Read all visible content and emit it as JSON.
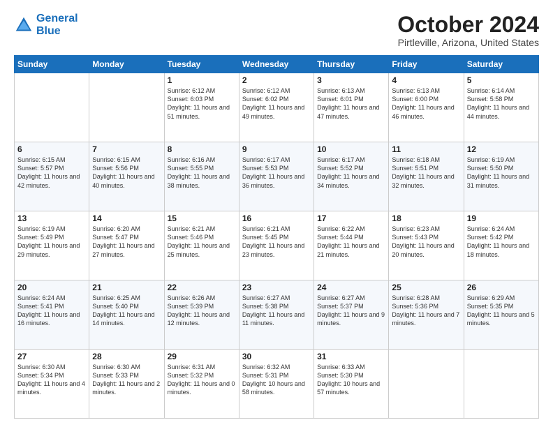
{
  "header": {
    "logo_line1": "General",
    "logo_line2": "Blue",
    "month": "October 2024",
    "location": "Pirtleville, Arizona, United States"
  },
  "days_of_week": [
    "Sunday",
    "Monday",
    "Tuesday",
    "Wednesday",
    "Thursday",
    "Friday",
    "Saturday"
  ],
  "weeks": [
    [
      {
        "day": "",
        "sunrise": "",
        "sunset": "",
        "daylight": ""
      },
      {
        "day": "",
        "sunrise": "",
        "sunset": "",
        "daylight": ""
      },
      {
        "day": "1",
        "sunrise": "Sunrise: 6:12 AM",
        "sunset": "Sunset: 6:03 PM",
        "daylight": "Daylight: 11 hours and 51 minutes."
      },
      {
        "day": "2",
        "sunrise": "Sunrise: 6:12 AM",
        "sunset": "Sunset: 6:02 PM",
        "daylight": "Daylight: 11 hours and 49 minutes."
      },
      {
        "day": "3",
        "sunrise": "Sunrise: 6:13 AM",
        "sunset": "Sunset: 6:01 PM",
        "daylight": "Daylight: 11 hours and 47 minutes."
      },
      {
        "day": "4",
        "sunrise": "Sunrise: 6:13 AM",
        "sunset": "Sunset: 6:00 PM",
        "daylight": "Daylight: 11 hours and 46 minutes."
      },
      {
        "day": "5",
        "sunrise": "Sunrise: 6:14 AM",
        "sunset": "Sunset: 5:58 PM",
        "daylight": "Daylight: 11 hours and 44 minutes."
      }
    ],
    [
      {
        "day": "6",
        "sunrise": "Sunrise: 6:15 AM",
        "sunset": "Sunset: 5:57 PM",
        "daylight": "Daylight: 11 hours and 42 minutes."
      },
      {
        "day": "7",
        "sunrise": "Sunrise: 6:15 AM",
        "sunset": "Sunset: 5:56 PM",
        "daylight": "Daylight: 11 hours and 40 minutes."
      },
      {
        "day": "8",
        "sunrise": "Sunrise: 6:16 AM",
        "sunset": "Sunset: 5:55 PM",
        "daylight": "Daylight: 11 hours and 38 minutes."
      },
      {
        "day": "9",
        "sunrise": "Sunrise: 6:17 AM",
        "sunset": "Sunset: 5:53 PM",
        "daylight": "Daylight: 11 hours and 36 minutes."
      },
      {
        "day": "10",
        "sunrise": "Sunrise: 6:17 AM",
        "sunset": "Sunset: 5:52 PM",
        "daylight": "Daylight: 11 hours and 34 minutes."
      },
      {
        "day": "11",
        "sunrise": "Sunrise: 6:18 AM",
        "sunset": "Sunset: 5:51 PM",
        "daylight": "Daylight: 11 hours and 32 minutes."
      },
      {
        "day": "12",
        "sunrise": "Sunrise: 6:19 AM",
        "sunset": "Sunset: 5:50 PM",
        "daylight": "Daylight: 11 hours and 31 minutes."
      }
    ],
    [
      {
        "day": "13",
        "sunrise": "Sunrise: 6:19 AM",
        "sunset": "Sunset: 5:49 PM",
        "daylight": "Daylight: 11 hours and 29 minutes."
      },
      {
        "day": "14",
        "sunrise": "Sunrise: 6:20 AM",
        "sunset": "Sunset: 5:47 PM",
        "daylight": "Daylight: 11 hours and 27 minutes."
      },
      {
        "day": "15",
        "sunrise": "Sunrise: 6:21 AM",
        "sunset": "Sunset: 5:46 PM",
        "daylight": "Daylight: 11 hours and 25 minutes."
      },
      {
        "day": "16",
        "sunrise": "Sunrise: 6:21 AM",
        "sunset": "Sunset: 5:45 PM",
        "daylight": "Daylight: 11 hours and 23 minutes."
      },
      {
        "day": "17",
        "sunrise": "Sunrise: 6:22 AM",
        "sunset": "Sunset: 5:44 PM",
        "daylight": "Daylight: 11 hours and 21 minutes."
      },
      {
        "day": "18",
        "sunrise": "Sunrise: 6:23 AM",
        "sunset": "Sunset: 5:43 PM",
        "daylight": "Daylight: 11 hours and 20 minutes."
      },
      {
        "day": "19",
        "sunrise": "Sunrise: 6:24 AM",
        "sunset": "Sunset: 5:42 PM",
        "daylight": "Daylight: 11 hours and 18 minutes."
      }
    ],
    [
      {
        "day": "20",
        "sunrise": "Sunrise: 6:24 AM",
        "sunset": "Sunset: 5:41 PM",
        "daylight": "Daylight: 11 hours and 16 minutes."
      },
      {
        "day": "21",
        "sunrise": "Sunrise: 6:25 AM",
        "sunset": "Sunset: 5:40 PM",
        "daylight": "Daylight: 11 hours and 14 minutes."
      },
      {
        "day": "22",
        "sunrise": "Sunrise: 6:26 AM",
        "sunset": "Sunset: 5:39 PM",
        "daylight": "Daylight: 11 hours and 12 minutes."
      },
      {
        "day": "23",
        "sunrise": "Sunrise: 6:27 AM",
        "sunset": "Sunset: 5:38 PM",
        "daylight": "Daylight: 11 hours and 11 minutes."
      },
      {
        "day": "24",
        "sunrise": "Sunrise: 6:27 AM",
        "sunset": "Sunset: 5:37 PM",
        "daylight": "Daylight: 11 hours and 9 minutes."
      },
      {
        "day": "25",
        "sunrise": "Sunrise: 6:28 AM",
        "sunset": "Sunset: 5:36 PM",
        "daylight": "Daylight: 11 hours and 7 minutes."
      },
      {
        "day": "26",
        "sunrise": "Sunrise: 6:29 AM",
        "sunset": "Sunset: 5:35 PM",
        "daylight": "Daylight: 11 hours and 5 minutes."
      }
    ],
    [
      {
        "day": "27",
        "sunrise": "Sunrise: 6:30 AM",
        "sunset": "Sunset: 5:34 PM",
        "daylight": "Daylight: 11 hours and 4 minutes."
      },
      {
        "day": "28",
        "sunrise": "Sunrise: 6:30 AM",
        "sunset": "Sunset: 5:33 PM",
        "daylight": "Daylight: 11 hours and 2 minutes."
      },
      {
        "day": "29",
        "sunrise": "Sunrise: 6:31 AM",
        "sunset": "Sunset: 5:32 PM",
        "daylight": "Daylight: 11 hours and 0 minutes."
      },
      {
        "day": "30",
        "sunrise": "Sunrise: 6:32 AM",
        "sunset": "Sunset: 5:31 PM",
        "daylight": "Daylight: 10 hours and 58 minutes."
      },
      {
        "day": "31",
        "sunrise": "Sunrise: 6:33 AM",
        "sunset": "Sunset: 5:30 PM",
        "daylight": "Daylight: 10 hours and 57 minutes."
      },
      {
        "day": "",
        "sunrise": "",
        "sunset": "",
        "daylight": ""
      },
      {
        "day": "",
        "sunrise": "",
        "sunset": "",
        "daylight": ""
      }
    ]
  ]
}
